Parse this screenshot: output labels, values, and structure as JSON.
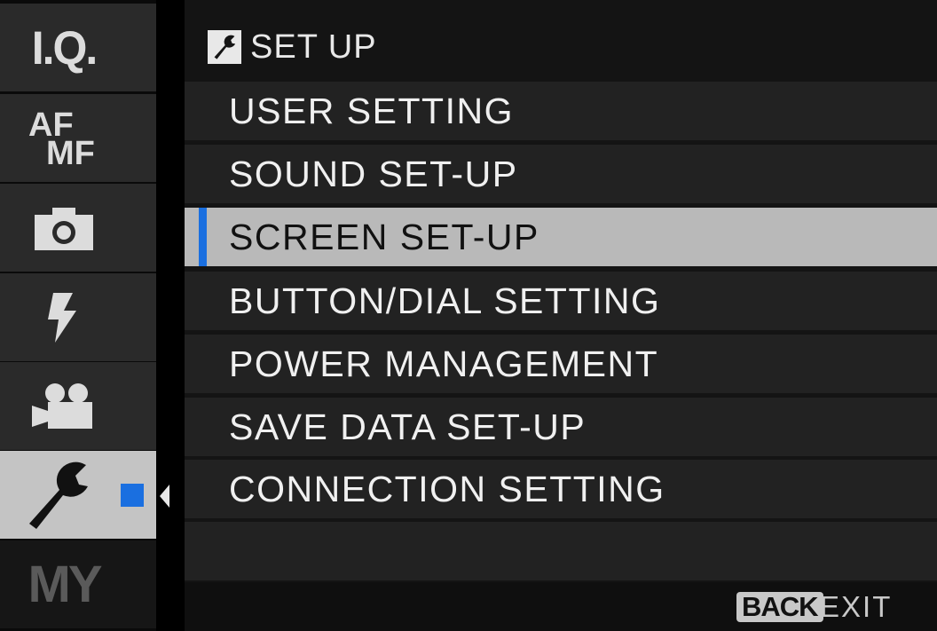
{
  "sidebar": {
    "tabs": [
      {
        "label": "I.Q.",
        "icon": "image-quality-icon"
      },
      {
        "label_top": "AF",
        "label_bottom": "MF",
        "icon": "af-mf-icon"
      },
      {
        "icon": "camera-icon"
      },
      {
        "icon": "flash-icon"
      },
      {
        "icon": "movie-camera-icon"
      },
      {
        "icon": "wrench-icon",
        "active": true
      },
      {
        "label": "MY",
        "icon": "my-menu-icon",
        "disabled": true
      }
    ],
    "selection_color": "#1a6fe0"
  },
  "header": {
    "icon": "wrench-icon",
    "title": "SET UP"
  },
  "menu": {
    "items": [
      {
        "label": "USER SETTING"
      },
      {
        "label": "SOUND SET-UP"
      },
      {
        "label": "SCREEN SET-UP",
        "selected": true
      },
      {
        "label": "BUTTON/DIAL SETTING"
      },
      {
        "label": "POWER MANAGEMENT"
      },
      {
        "label": "SAVE DATA SET-UP"
      },
      {
        "label": "CONNECTION SETTING"
      }
    ]
  },
  "footer": {
    "back_key": "BACK",
    "exit_label": "EXIT"
  }
}
